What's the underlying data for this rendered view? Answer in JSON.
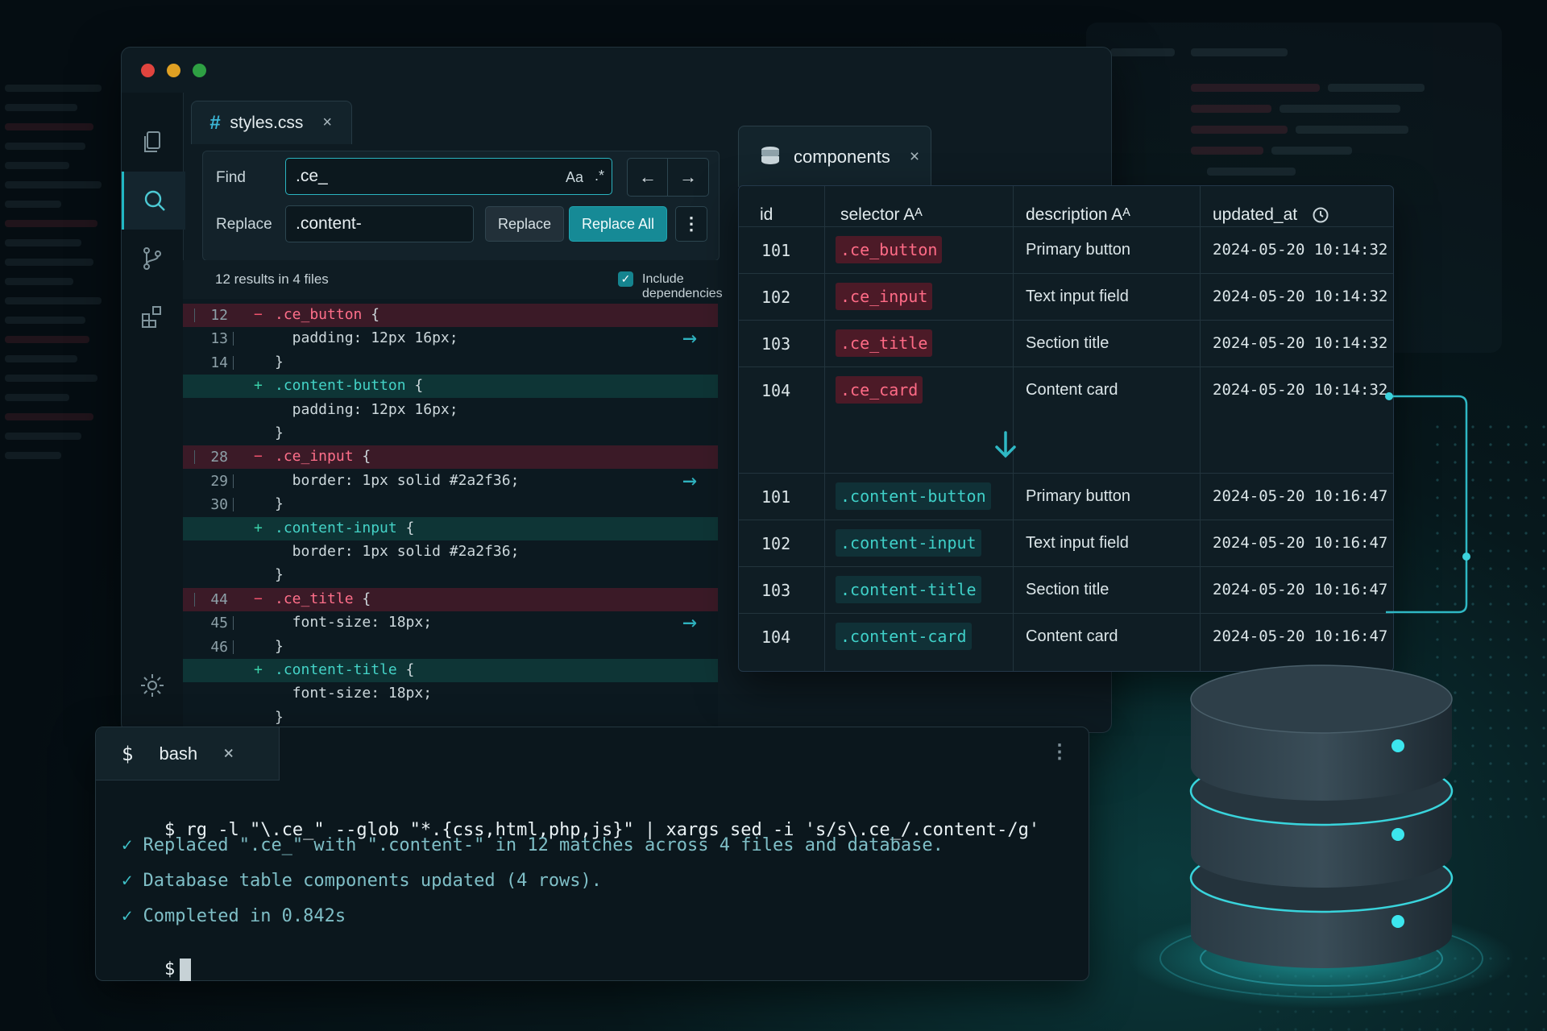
{
  "editor": {
    "tab": {
      "icon": "hash-icon",
      "label": "styles.css",
      "close": "×"
    },
    "activity_icons": [
      "files-icon",
      "search-icon",
      "git-branch-icon",
      "extensions-icon",
      "settings-icon"
    ],
    "find": {
      "find_label": "Find",
      "find_value": ".ce_",
      "match_case": "Aa",
      "regex": ".*",
      "prev": "←",
      "next": "→",
      "replace_label": "Replace",
      "replace_value": ".content-",
      "replace_button": "Replace",
      "replace_all_button": "Replace All",
      "more": "⋮"
    },
    "results": {
      "summary": "12 results in 4 files",
      "include_deps": "Include dependencies",
      "include_deps_checked": true
    },
    "lines": [
      {
        "n": "12",
        "type": "del",
        "sign": "−",
        "sel": ".ce_button",
        "rest": " {",
        "arrow": false
      },
      {
        "n": "13",
        "type": "ctx",
        "sign": "",
        "sel": "",
        "rest": "  padding: 12px 16px;",
        "arrow": true
      },
      {
        "n": "14",
        "type": "ctx",
        "sign": "",
        "sel": "",
        "rest": "}",
        "arrow": false
      },
      {
        "n": "",
        "type": "add",
        "sign": "+",
        "sel": ".content-button",
        "rest": " {",
        "arrow": false
      },
      {
        "n": "",
        "type": "ctx",
        "sign": "",
        "sel": "",
        "rest": "  padding: 12px 16px;",
        "arrow": false
      },
      {
        "n": "",
        "type": "ctx",
        "sign": "",
        "sel": "",
        "rest": "}",
        "arrow": false
      },
      {
        "n": "28",
        "type": "del",
        "sign": "−",
        "sel": ".ce_input",
        "rest": " {",
        "arrow": false
      },
      {
        "n": "29",
        "type": "ctx",
        "sign": "",
        "sel": "",
        "rest": "  border: 1px solid #2a2f36;",
        "arrow": true
      },
      {
        "n": "30",
        "type": "ctx",
        "sign": "",
        "sel": "",
        "rest": "}",
        "arrow": false
      },
      {
        "n": "",
        "type": "add",
        "sign": "+",
        "sel": ".content-input",
        "rest": " {",
        "arrow": false
      },
      {
        "n": "",
        "type": "ctx",
        "sign": "",
        "sel": "",
        "rest": "  border: 1px solid #2a2f36;",
        "arrow": false
      },
      {
        "n": "",
        "type": "ctx",
        "sign": "",
        "sel": "",
        "rest": "}",
        "arrow": false
      },
      {
        "n": "44",
        "type": "del",
        "sign": "−",
        "sel": ".ce_title",
        "rest": " {",
        "arrow": false
      },
      {
        "n": "45",
        "type": "ctx",
        "sign": "",
        "sel": "",
        "rest": "  font-size: 18px;",
        "arrow": true
      },
      {
        "n": "46",
        "type": "ctx",
        "sign": "",
        "sel": "",
        "rest": "}",
        "arrow": false
      },
      {
        "n": "",
        "type": "add",
        "sign": "+",
        "sel": ".content-title",
        "rest": " {",
        "arrow": false
      },
      {
        "n": "",
        "type": "ctx",
        "sign": "",
        "sel": "",
        "rest": "  font-size: 18px;",
        "arrow": false
      },
      {
        "n": "",
        "type": "ctx",
        "sign": "",
        "sel": "",
        "rest": "}",
        "arrow": false
      }
    ]
  },
  "table": {
    "tab": {
      "icon": "database-icon",
      "label": "components",
      "close": "×"
    },
    "headers": {
      "id": "id",
      "selector": "selector Aᴬ",
      "description": "description Aᴬ",
      "updated_at": "updated_at"
    },
    "before": [
      {
        "id": "101",
        "selector": ".ce_button",
        "description": "Primary button",
        "updated_at": "2024-05-20 10:14:32"
      },
      {
        "id": "102",
        "selector": ".ce_input",
        "description": "Text input field",
        "updated_at": "2024-05-20 10:14:32"
      },
      {
        "id": "103",
        "selector": ".ce_title",
        "description": "Section title",
        "updated_at": "2024-05-20 10:14:32"
      },
      {
        "id": "104",
        "selector": ".ce_card",
        "description": "Content card",
        "updated_at": "2024-05-20 10:14:32"
      }
    ],
    "after": [
      {
        "id": "101",
        "selector": ".content-button",
        "description": "Primary button",
        "updated_at": "2024-05-20 10:16:47"
      },
      {
        "id": "102",
        "selector": ".content-input",
        "description": "Text input field",
        "updated_at": "2024-05-20 10:16:47"
      },
      {
        "id": "103",
        "selector": ".content-title",
        "description": "Section title",
        "updated_at": "2024-05-20 10:16:47"
      },
      {
        "id": "104",
        "selector": ".content-card",
        "description": "Content card",
        "updated_at": "2024-05-20 10:16:47"
      }
    ]
  },
  "terminal": {
    "tab": {
      "prompt_icon": "$",
      "label": "bash",
      "close": "×",
      "more": "⋮"
    },
    "command_prompt": "$",
    "command": "rg -l \"\\.ce_\" --glob \"*.{css,html,php,js}\" | xargs sed -i 's/s\\.ce_/.content-/g'",
    "check": "✓",
    "results": [
      "Replaced \".ce_\" with \".content-\" in 12 matches across 4 files and database.",
      "Database table components updated (4 rows).",
      "Completed in 0.842s"
    ],
    "final_prompt": "$"
  },
  "colors": {
    "accent": "#1fa6b2",
    "removed": "#ff6b86",
    "added": "#3fd0c8",
    "background": "#050d12"
  }
}
